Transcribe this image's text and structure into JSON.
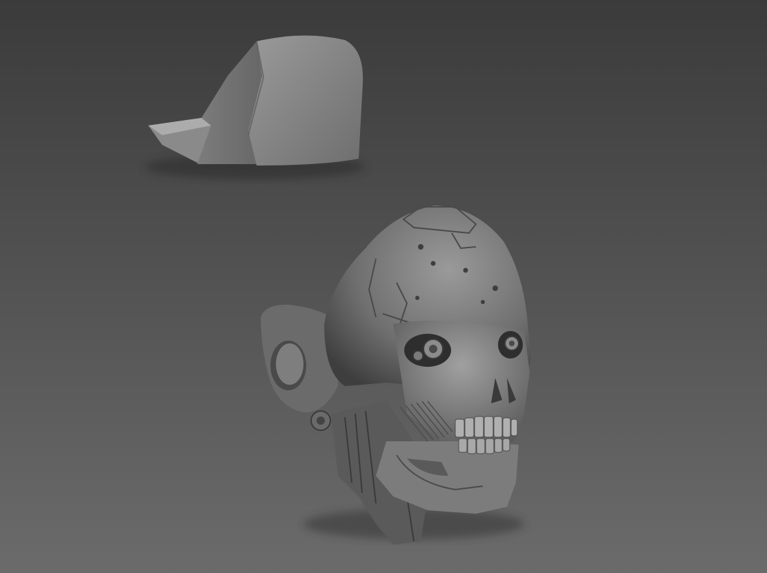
{
  "viewport": {
    "background_top": "#3b3b3b",
    "background_bottom": "#6b6b6b",
    "objects": [
      {
        "name": "cap-mesh",
        "icon": "cap-sculpt"
      },
      {
        "name": "cyborg-skull-mesh",
        "icon": "skull-sculpt"
      }
    ],
    "material_color": "#8a8a8a",
    "shadow_color": "#2a2a2a"
  }
}
